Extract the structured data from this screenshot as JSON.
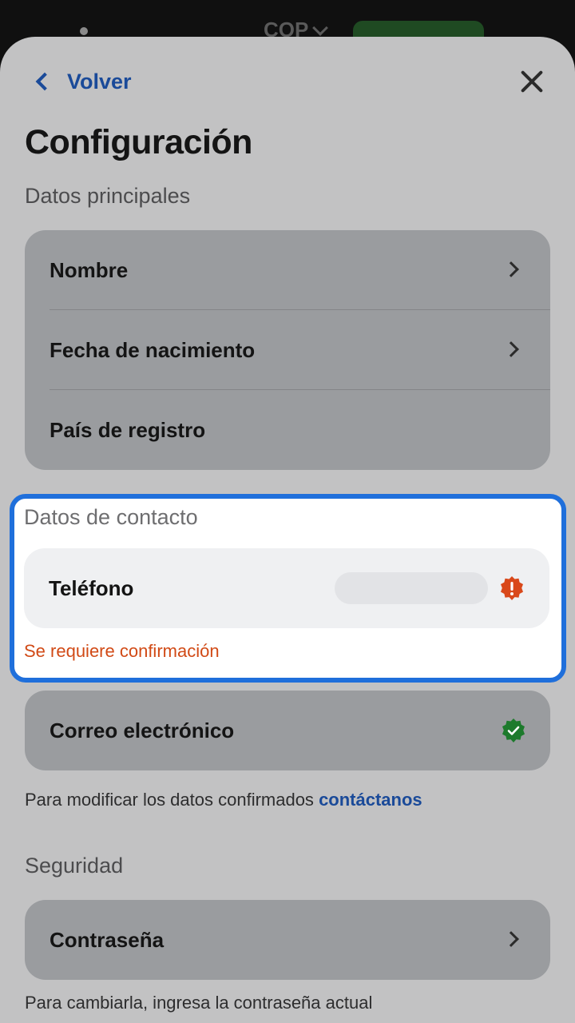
{
  "background_app": {
    "currency": "COP"
  },
  "header": {
    "back_label": "Volver",
    "title": "Configuración"
  },
  "main_section": {
    "title": "Datos principales",
    "items": [
      {
        "label": "Nombre"
      },
      {
        "label": "Fecha de nacimiento"
      },
      {
        "label": "País de registro"
      }
    ]
  },
  "contact_section": {
    "title": "Datos de contacto",
    "phone_label": "Teléfono",
    "phone_error": "Se requiere confirmación",
    "email_label": "Correo electrónico",
    "note_prefix": "Para modificar los datos confirmados",
    "note_link": "contáctanos"
  },
  "security_section": {
    "title": "Seguridad",
    "password_label": "Contraseña",
    "note": "Para cambiarla, ingresa la contraseña actual"
  },
  "colors": {
    "accent": "#1a4a99",
    "highlight_border": "#1f6fdb",
    "warning": "#d9481a",
    "success": "#1d7a2c"
  },
  "icons": {
    "back": "chevron-left-icon",
    "close": "close-icon",
    "row": "chevron-right-icon",
    "warning": "warning-badge-icon",
    "success": "check-badge-icon"
  }
}
